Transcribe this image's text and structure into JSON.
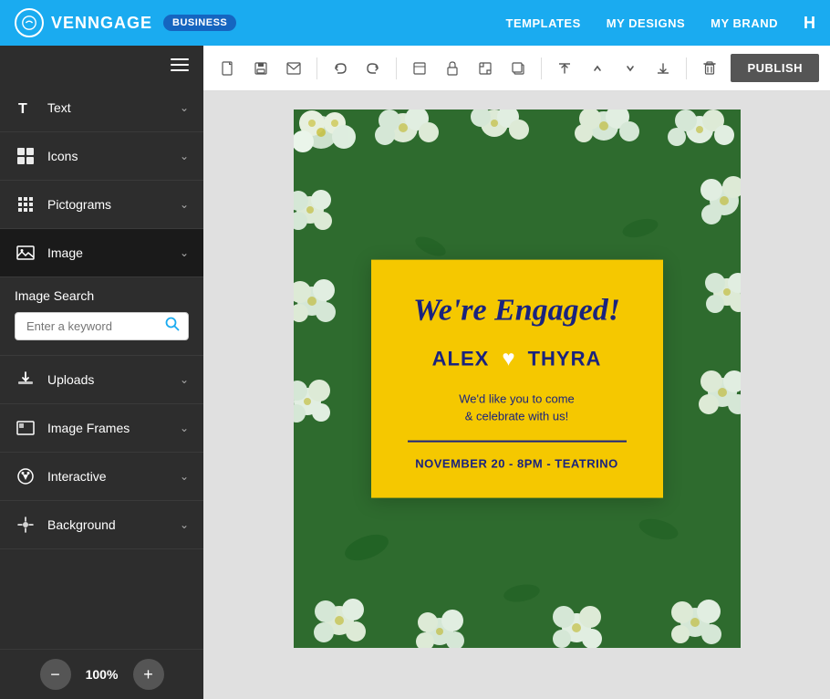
{
  "nav": {
    "logo_text": "VENNGAGE",
    "badge": "BUSINESS",
    "links": [
      "TEMPLATES",
      "MY DESIGNS",
      "MY BRAND"
    ],
    "more": "H"
  },
  "sidebar": {
    "hamburger_title": "Menu",
    "items": [
      {
        "id": "text",
        "label": "Text",
        "icon": "text-icon"
      },
      {
        "id": "icons",
        "label": "Icons",
        "icon": "icons-icon"
      },
      {
        "id": "pictograms",
        "label": "Pictograms",
        "icon": "pictograms-icon"
      },
      {
        "id": "image",
        "label": "Image",
        "icon": "image-icon",
        "active": true
      },
      {
        "id": "uploads",
        "label": "Uploads",
        "icon": "uploads-icon"
      },
      {
        "id": "image-frames",
        "label": "Image Frames",
        "icon": "image-frames-icon"
      },
      {
        "id": "interactive",
        "label": "Interactive",
        "icon": "interactive-icon"
      },
      {
        "id": "background",
        "label": "Background",
        "icon": "background-icon"
      }
    ],
    "image_search": {
      "title": "Image Search",
      "placeholder": "Enter a keyword"
    },
    "zoom": {
      "value": "100%",
      "minus_label": "−",
      "plus_label": "+"
    }
  },
  "toolbar": {
    "publish_label": "PUBLISH",
    "tool_icons": [
      "file-icon",
      "save-icon",
      "email-icon",
      "undo-icon",
      "redo-icon",
      "resize-icon",
      "lock-icon",
      "edit-icon",
      "duplicate-icon",
      "move-up-icon",
      "up-icon",
      "down-icon",
      "move-down-icon",
      "delete-icon"
    ]
  },
  "canvas": {
    "card": {
      "title": "We're Engaged!",
      "name1": "ALEX",
      "heart": "♥",
      "name2": "THYRA",
      "subtitle_line1": "We'd like you to come",
      "subtitle_line2": "& celebrate with us!",
      "details": "NOVEMBER 20 - 8PM - TEATRINO"
    }
  }
}
